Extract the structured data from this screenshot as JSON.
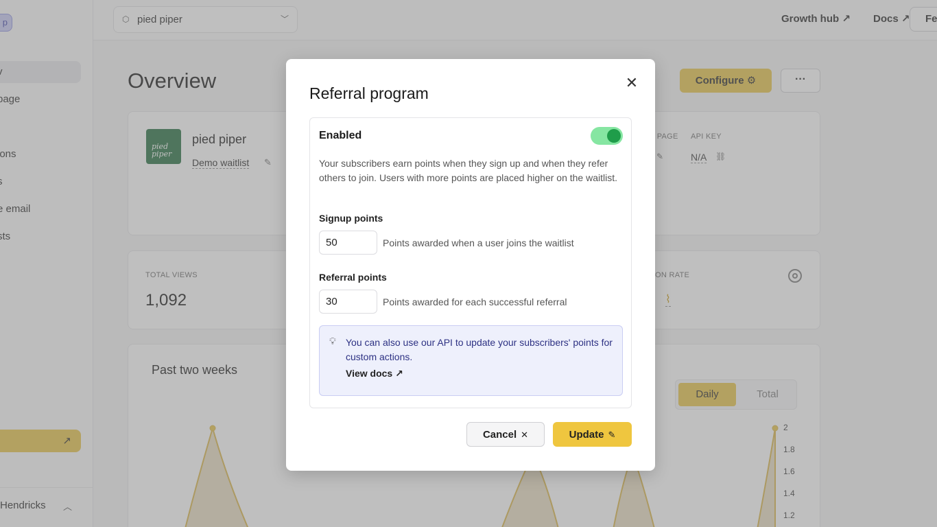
{
  "sidebar": {
    "badge": "p",
    "items": [
      {
        "label": "v",
        "active": true
      },
      {
        "label": "page"
      },
      {
        "label": "ions"
      },
      {
        "label": "s"
      },
      {
        "label": "e email"
      },
      {
        "label": "sts"
      }
    ],
    "user_name": "Hendricks"
  },
  "topbar": {
    "project_select": "pied piper",
    "links": [
      {
        "label": "Growth hub ↗"
      },
      {
        "label": "Docs ↗"
      }
    ],
    "feedback_button": "Fe"
  },
  "page": {
    "title": "Overview",
    "configure_label": "Configure ⚙",
    "more_label": "···"
  },
  "project_card": {
    "logo_text": "pied piper",
    "name": "pied piper",
    "subtitle": "Demo waitlist",
    "meta": [
      {
        "label": "I PAGE"
      },
      {
        "label": "API KEY",
        "value": "N/A"
      }
    ]
  },
  "stats_card": {
    "total_views_label": "TOTAL VIEWS",
    "total_views_value": "1,092",
    "conversion_label": "ON RATE"
  },
  "chart_card": {
    "title": "Past two weeks",
    "toggle": {
      "daily": "Daily",
      "total": "Total",
      "selected": "Daily"
    }
  },
  "chart_data": {
    "type": "area",
    "title": "Past two weeks",
    "y_ticks": [
      "2",
      "1.8",
      "1.6",
      "1.4",
      "1.2"
    ],
    "color": "#e7c343"
  },
  "modal": {
    "title": "Referral program",
    "enabled_label": "Enabled",
    "enabled": true,
    "description": "Your subscribers earn points when they sign up and when they refer others to join. Users with more points are placed higher on the waitlist.",
    "signup": {
      "label": "Signup points",
      "value": "50",
      "help": "Points awarded when a user joins the waitlist"
    },
    "referral": {
      "label": "Referral points",
      "value": "30",
      "help": "Points awarded for each successful referral"
    },
    "tip": {
      "text": "You can also use our API to update your subscribers' points for custom actions.",
      "link": "View docs ↗"
    },
    "cancel_label": "Cancel",
    "update_label": "Update"
  },
  "colors": {
    "accent": "#efc63f",
    "toggle_on": "#1f9d4a",
    "tip_bg": "#eef0fc"
  }
}
